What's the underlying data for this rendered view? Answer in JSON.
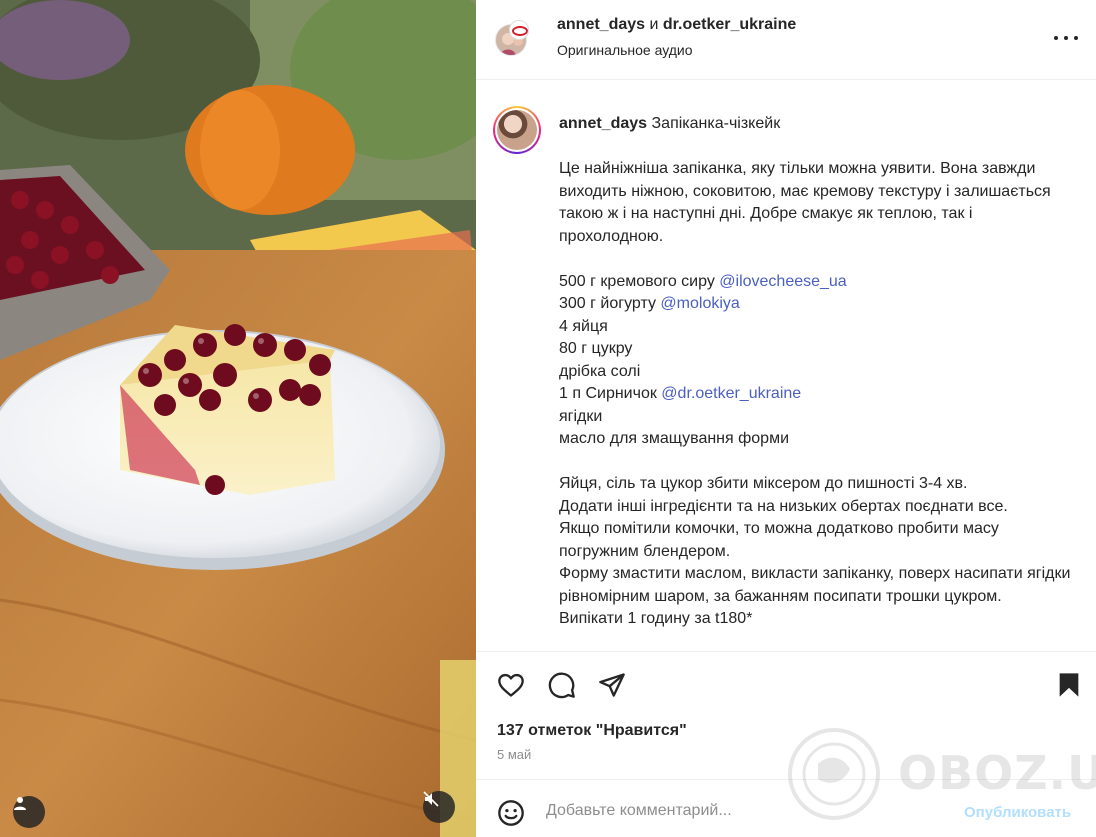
{
  "header": {
    "author_primary": "annet_days",
    "separator": "и",
    "author_secondary": "dr.oetker_ukraine",
    "audio": "Оригинальное аудио"
  },
  "caption": {
    "username": "annet_days",
    "title": "Запіканка-чізкейк",
    "intro": [
      "Це найніжніша запіканка, яку тільки можна уявити. Вона завжди виходить ніжною, соковитою, має кремову текстуру і залишається такою ж і на наступні дні. Добре смакує як теплою, так і прохолодною."
    ],
    "ingredients": [
      {
        "text": "500 г кремового сиру ",
        "mention": "@ilovecheese_ua"
      },
      {
        "text": "300 г йогурту ",
        "mention": "@molokiya"
      },
      {
        "text": "4 яйця",
        "mention": ""
      },
      {
        "text": "80 г цукру",
        "mention": ""
      },
      {
        "text": "дрібка солі",
        "mention": ""
      },
      {
        "text": "1 п Сирничок ",
        "mention": "@dr.oetker_ukraine"
      },
      {
        "text": "ягідки",
        "mention": ""
      },
      {
        "text": "масло для змащування форми",
        "mention": ""
      }
    ],
    "steps": [
      "Яйця, сіль та цукор збити міксером до пишності 3-4 хв.",
      "Додати інші інгредієнти та на низьких обертах поєднати все.",
      "Якщо помітили комочки, то можна додатково пробити масу погружним блендером.",
      "Форму змастити маслом, викласти запіканку, поверх насипати ягідки рівномірним шаром, за бажанням посипати трошки цукром.",
      "Випікати 1 годину за t180*"
    ]
  },
  "stats": {
    "likes": "137 отметок \"Нравится\"",
    "date": "5 май"
  },
  "comment": {
    "placeholder": "Добавьте комментарий...",
    "publish": "Опубликовать"
  },
  "icons": {
    "more": "more-horizontal-icon",
    "like": "heart-icon",
    "comment": "comment-icon",
    "share": "paper-plane-icon",
    "save": "bookmark-icon",
    "emoji": "emoji-icon",
    "user": "user-icon",
    "mute": "muted-speaker-icon"
  },
  "watermark": {
    "text": "OBOZ.UA"
  },
  "colors": {
    "mention": "#4a5fc1",
    "publish_disabled": "#b2dffc",
    "muted_text": "#8e8e8e",
    "divider": "#efefef"
  }
}
